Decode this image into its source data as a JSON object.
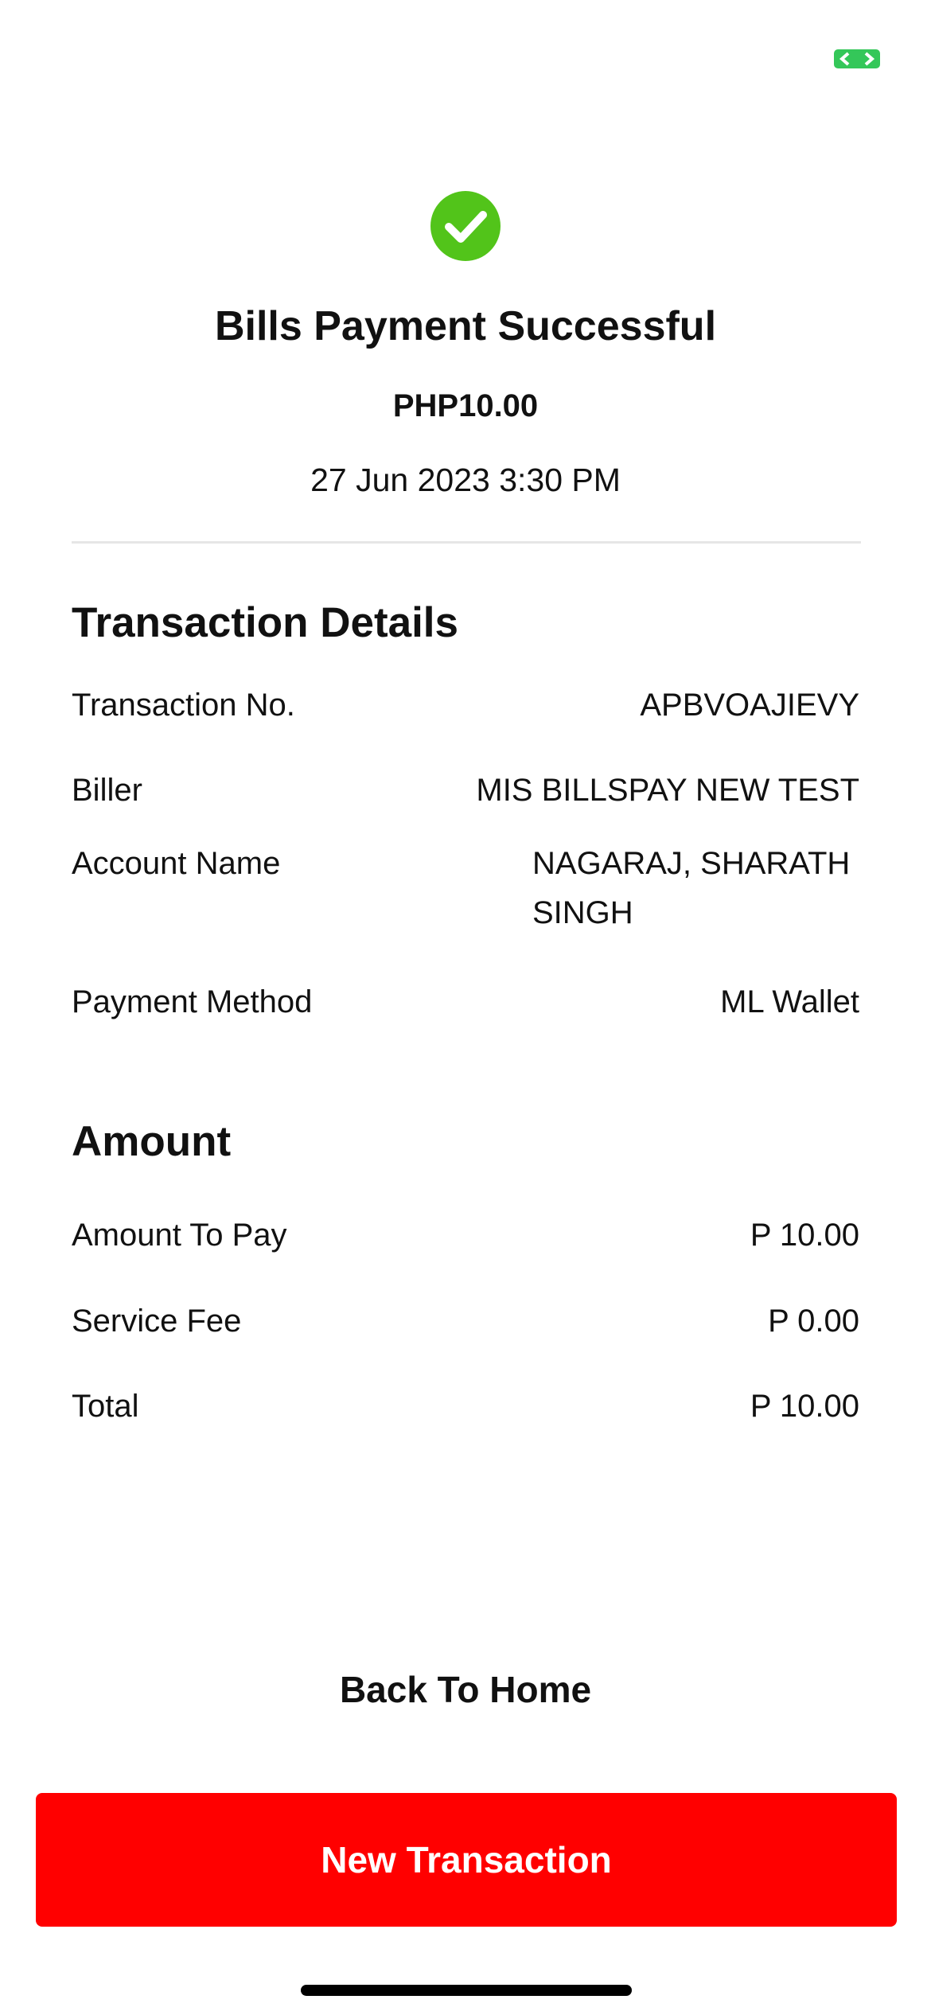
{
  "colors": {
    "success": "#52c41a",
    "primary_button": "#ff0000",
    "divider": "#e6e6e6",
    "text": "#111111",
    "status_indicator": "#34c759"
  },
  "icons": {
    "status": "camera-in-use-indicator-icon",
    "success": "check-circle-icon"
  },
  "summary": {
    "title": "Bills Payment Successful",
    "amount": "PHP10.00",
    "datetime": "27 Jun 2023 3:30 PM"
  },
  "transaction_details": {
    "heading": "Transaction Details",
    "rows": [
      {
        "label": "Transaction No.",
        "value": "APBVOAJIEVY"
      },
      {
        "label": "Biller",
        "value": "MIS BILLSPAY NEW TEST"
      },
      {
        "label": "Account Name",
        "value": "NAGARAJ, SHARATH SINGH"
      },
      {
        "label": "Payment Method",
        "value": "ML Wallet"
      }
    ]
  },
  "amount_section": {
    "heading": "Amount",
    "rows": [
      {
        "label": "Amount To Pay",
        "value": "P 10.00"
      },
      {
        "label": "Service Fee",
        "value": "P 0.00"
      },
      {
        "label": "Total",
        "value": "P 10.00"
      }
    ]
  },
  "actions": {
    "back_home": "Back To Home",
    "new_transaction": "New Transaction"
  }
}
